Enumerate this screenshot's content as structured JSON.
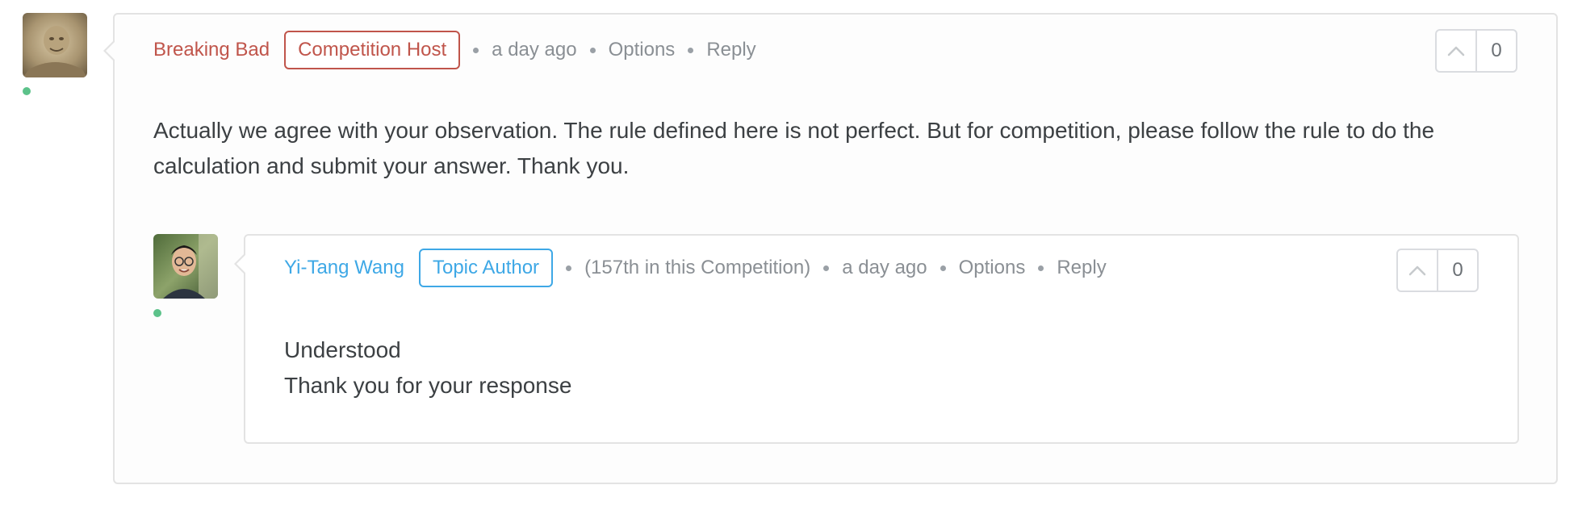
{
  "comment": {
    "author": "Breaking Bad",
    "badge": "Competition Host",
    "time": "a day ago",
    "options_label": "Options",
    "reply_label": "Reply",
    "vote_count": "0",
    "body": "Actually we agree with your observation. The rule defined here is not perfect. But for competition, please follow the rule to do the calculation and submit your answer. Thank you.",
    "online": true
  },
  "reply": {
    "author": "Yi-Tang Wang",
    "badge": "Topic Author",
    "rank": "(157th in this Competition)",
    "time": "a day ago",
    "options_label": "Options",
    "reply_label": "Reply",
    "vote_count": "0",
    "body_lines": [
      "Understood",
      "Thank you for your response"
    ],
    "online": true
  },
  "colors": {
    "host": "#c0554b",
    "topic_author": "#3ea8e6",
    "online": "#5cc28a"
  },
  "icons": {
    "upvote": "chevron-up-icon"
  }
}
